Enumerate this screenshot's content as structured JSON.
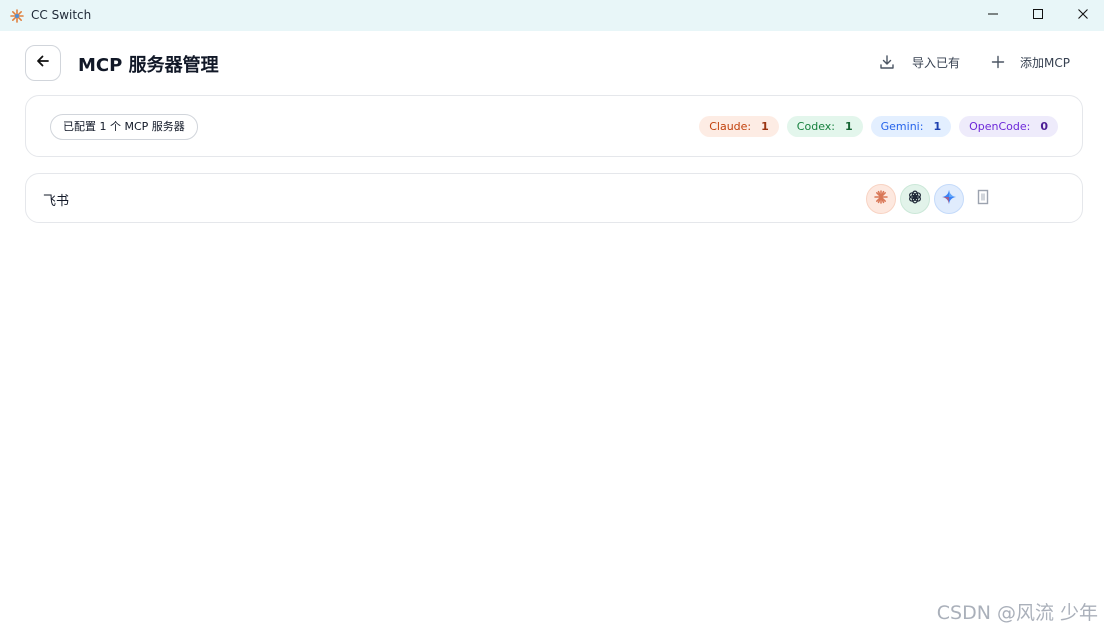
{
  "window": {
    "title": "CC Switch",
    "icon": "sunburst-app-icon",
    "controls": [
      "minimize-icon",
      "maximize-icon",
      "close-icon"
    ]
  },
  "header": {
    "back_icon": "arrow-left-icon",
    "title": "MCP 服务器管理",
    "import_label": "导入已有",
    "import_icon": "download-icon",
    "add_label": "添加MCP",
    "add_icon": "plus-icon"
  },
  "summary": {
    "count_text": "已配置 1 个 MCP 服务器",
    "badges": [
      {
        "label": "Claude:",
        "count": "1"
      },
      {
        "label": "Codex:",
        "count": "1"
      },
      {
        "label": "Gemini:",
        "count": "1"
      },
      {
        "label": "OpenCode:",
        "count": "0"
      }
    ]
  },
  "servers": [
    {
      "name": "飞书",
      "apps": [
        {
          "name": "claude",
          "icon": "claude-icon",
          "enabled": true
        },
        {
          "name": "codex",
          "icon": "openai-icon",
          "enabled": true
        },
        {
          "name": "gemini",
          "icon": "gemini-icon",
          "enabled": true
        },
        {
          "name": "opencode",
          "icon": "opencode-icon",
          "enabled": false
        }
      ]
    }
  ],
  "watermark": "CSDN @风流 少年",
  "colors": {
    "titlebar": "#e8f6f8",
    "claude": "#d97757",
    "codex": "#15803d",
    "gemini": "#2563eb",
    "opencode": "#6d28d9"
  }
}
